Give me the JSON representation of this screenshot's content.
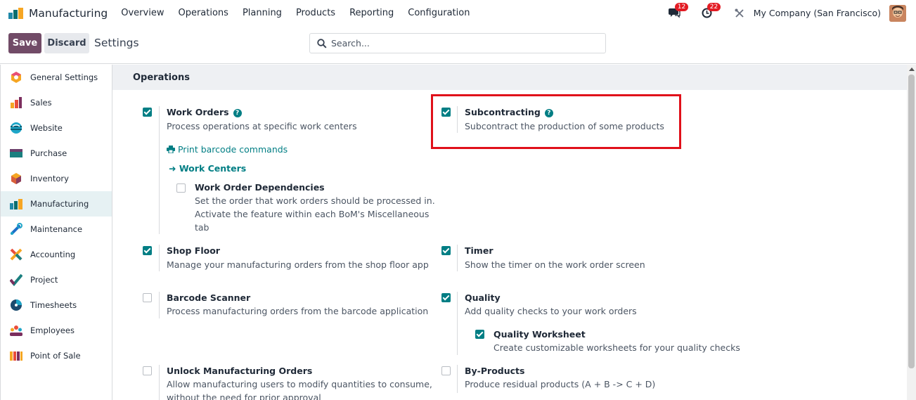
{
  "navbar": {
    "app_name": "Manufacturing",
    "menu": [
      "Overview",
      "Operations",
      "Planning",
      "Products",
      "Reporting",
      "Configuration"
    ],
    "messages_badge": "12",
    "activities_badge": "22",
    "company": "My Company (San Francisco)"
  },
  "control_panel": {
    "save_label": "Save",
    "discard_label": "Discard",
    "title": "Settings",
    "search_placeholder": "Search..."
  },
  "sidebar": {
    "items": [
      {
        "label": "General Settings",
        "icon": "odoo-logo-icon"
      },
      {
        "label": "Sales",
        "icon": "sales-chart-icon"
      },
      {
        "label": "Website",
        "icon": "website-globe-icon"
      },
      {
        "label": "Purchase",
        "icon": "purchase-card-icon"
      },
      {
        "label": "Inventory",
        "icon": "inventory-box-icon"
      },
      {
        "label": "Manufacturing",
        "icon": "manufacturing-bars-icon",
        "active": true
      },
      {
        "label": "Maintenance",
        "icon": "maintenance-wrench-icon"
      },
      {
        "label": "Accounting",
        "icon": "accounting-cross-icon"
      },
      {
        "label": "Project",
        "icon": "project-check-icon"
      },
      {
        "label": "Timesheets",
        "icon": "timesheets-clock-icon"
      },
      {
        "label": "Employees",
        "icon": "employees-people-icon"
      },
      {
        "label": "Point of Sale",
        "icon": "pos-store-icon"
      }
    ]
  },
  "section": {
    "title": "Operations"
  },
  "settings": {
    "work_orders": {
      "title": "Work Orders",
      "desc": "Process operations at specific work centers",
      "checked": true
    },
    "print_barcode": "Print barcode commands",
    "work_centers": "Work Centers",
    "wo_dependencies": {
      "title": "Work Order Dependencies",
      "desc1": "Set the order that work orders should be processed in.",
      "desc2": "Activate the feature within each BoM's Miscellaneous",
      "desc3": "tab",
      "checked": false
    },
    "subcontracting": {
      "title": "Subcontracting",
      "desc": "Subcontract the production of some products",
      "checked": true
    },
    "shop_floor": {
      "title": "Shop Floor",
      "desc": "Manage your manufacturing orders from the shop floor app",
      "checked": true
    },
    "timer": {
      "title": "Timer",
      "desc": "Show the timer on the work order screen",
      "checked": true
    },
    "barcode_scanner": {
      "title": "Barcode Scanner",
      "desc": "Process manufacturing orders from the barcode application",
      "checked": false
    },
    "quality": {
      "title": "Quality",
      "desc": "Add quality checks to your work orders",
      "checked": true
    },
    "quality_worksheet": {
      "title": "Quality Worksheet",
      "desc": "Create customizable worksheets for your quality checks",
      "checked": true
    },
    "unlock_mo": {
      "title": "Unlock Manufacturing Orders",
      "desc1": "Allow manufacturing users to modify quantities to consume,",
      "desc2": "without the need for prior approval",
      "checked": false
    },
    "by_products": {
      "title": "By-Products",
      "desc": "Produce residual products (A + B -> C + D)",
      "checked": false
    }
  },
  "colors": {
    "primary": "#714b67",
    "accent": "#017e84",
    "highlight": "#e0101a"
  }
}
